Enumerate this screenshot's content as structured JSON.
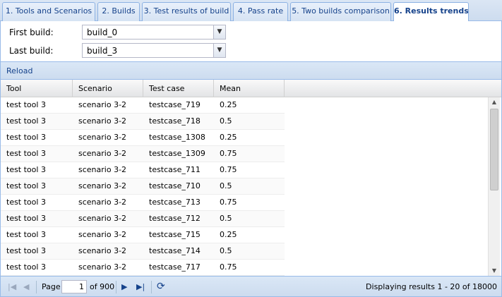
{
  "tabs": [
    {
      "label": "1. Tools and Scenarios",
      "active": false
    },
    {
      "label": "2. Builds",
      "active": false
    },
    {
      "label": "3. Test results of build",
      "active": false
    },
    {
      "label": "4. Pass rate",
      "active": false
    },
    {
      "label": "5. Two builds comparison",
      "active": false
    },
    {
      "label": "6. Results trends",
      "active": true
    }
  ],
  "form": {
    "first_build_label": "First build:",
    "first_build_value": "build_0",
    "last_build_label": "Last build:",
    "last_build_value": "build_3"
  },
  "toolbar": {
    "reload_label": "Reload"
  },
  "grid": {
    "columns": [
      "Tool",
      "Scenario",
      "Test case",
      "Mean"
    ],
    "rows": [
      [
        "test tool 3",
        "scenario 3-2",
        "testcase_719",
        "0.25"
      ],
      [
        "test tool 3",
        "scenario 3-2",
        "testcase_718",
        "0.5"
      ],
      [
        "test tool 3",
        "scenario 3-2",
        "testcase_1308",
        "0.25"
      ],
      [
        "test tool 3",
        "scenario 3-2",
        "testcase_1309",
        "0.75"
      ],
      [
        "test tool 3",
        "scenario 3-2",
        "testcase_711",
        "0.75"
      ],
      [
        "test tool 3",
        "scenario 3-2",
        "testcase_710",
        "0.5"
      ],
      [
        "test tool 3",
        "scenario 3-2",
        "testcase_713",
        "0.75"
      ],
      [
        "test tool 3",
        "scenario 3-2",
        "testcase_712",
        "0.5"
      ],
      [
        "test tool 3",
        "scenario 3-2",
        "testcase_715",
        "0.25"
      ],
      [
        "test tool 3",
        "scenario 3-2",
        "testcase_714",
        "0.5"
      ],
      [
        "test tool 3",
        "scenario 3-2",
        "testcase_717",
        "0.75"
      ]
    ]
  },
  "pager": {
    "page_label": "Page",
    "page_value": "1",
    "of_label": "of 900",
    "display_text": "Displaying results 1 - 20 of 18000"
  }
}
